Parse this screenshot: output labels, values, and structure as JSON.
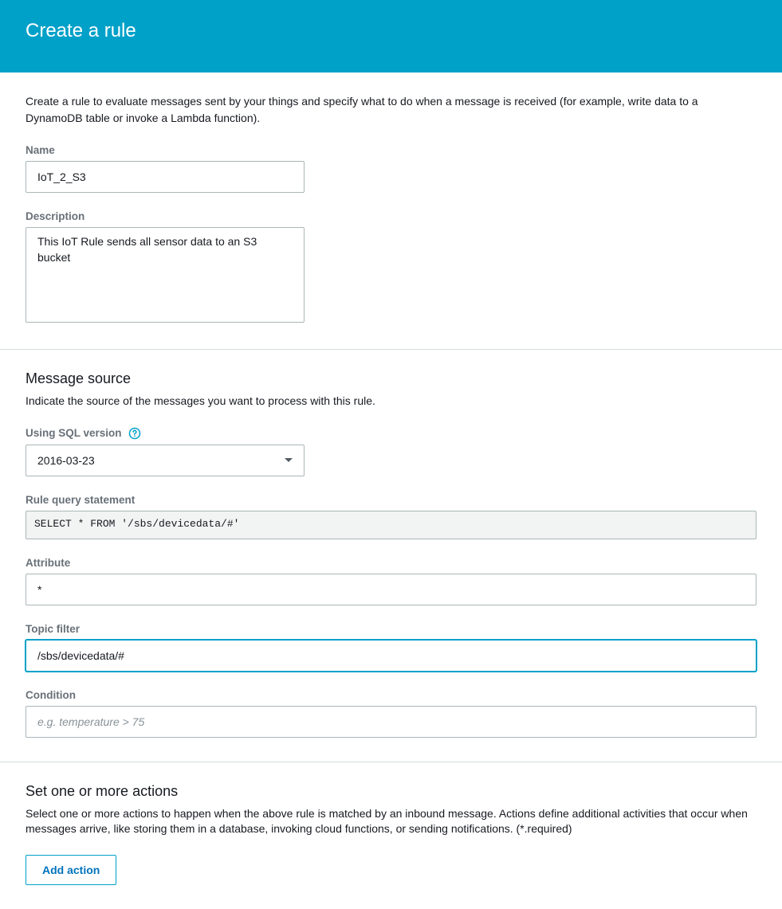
{
  "header": {
    "title": "Create a rule"
  },
  "intro": "Create a rule to evaluate messages sent by your things and specify what to do when a message is received (for example, write data to a DynamoDB table or invoke a Lambda function).",
  "fields": {
    "name_label": "Name",
    "name_value": "IoT_2_S3",
    "description_label": "Description",
    "description_value": "This IoT Rule sends all sensor data to an S3 bucket"
  },
  "message_source": {
    "heading": "Message source",
    "sub": "Indicate the source of the messages you want to process with this rule.",
    "sql_version_label": "Using SQL version",
    "sql_version_value": "2016-03-23",
    "query_label": "Rule query statement",
    "query_value": "SELECT * FROM '/sbs/devicedata/#'",
    "attribute_label": "Attribute",
    "attribute_value": "*",
    "topic_label": "Topic filter",
    "topic_value": "/sbs/devicedata/#",
    "condition_label": "Condition",
    "condition_placeholder": "e.g. temperature > 75",
    "condition_value": ""
  },
  "actions": {
    "heading": "Set one or more actions",
    "sub": "Select one or more actions to happen when the above rule is matched by an inbound message. Actions define additional activities that occur when messages arrive, like storing them in a database, invoking cloud functions, or sending notifications. (*.required)",
    "add_button": "Add action"
  },
  "colors": {
    "accent": "#00a1c9",
    "link": "#0073bb"
  }
}
